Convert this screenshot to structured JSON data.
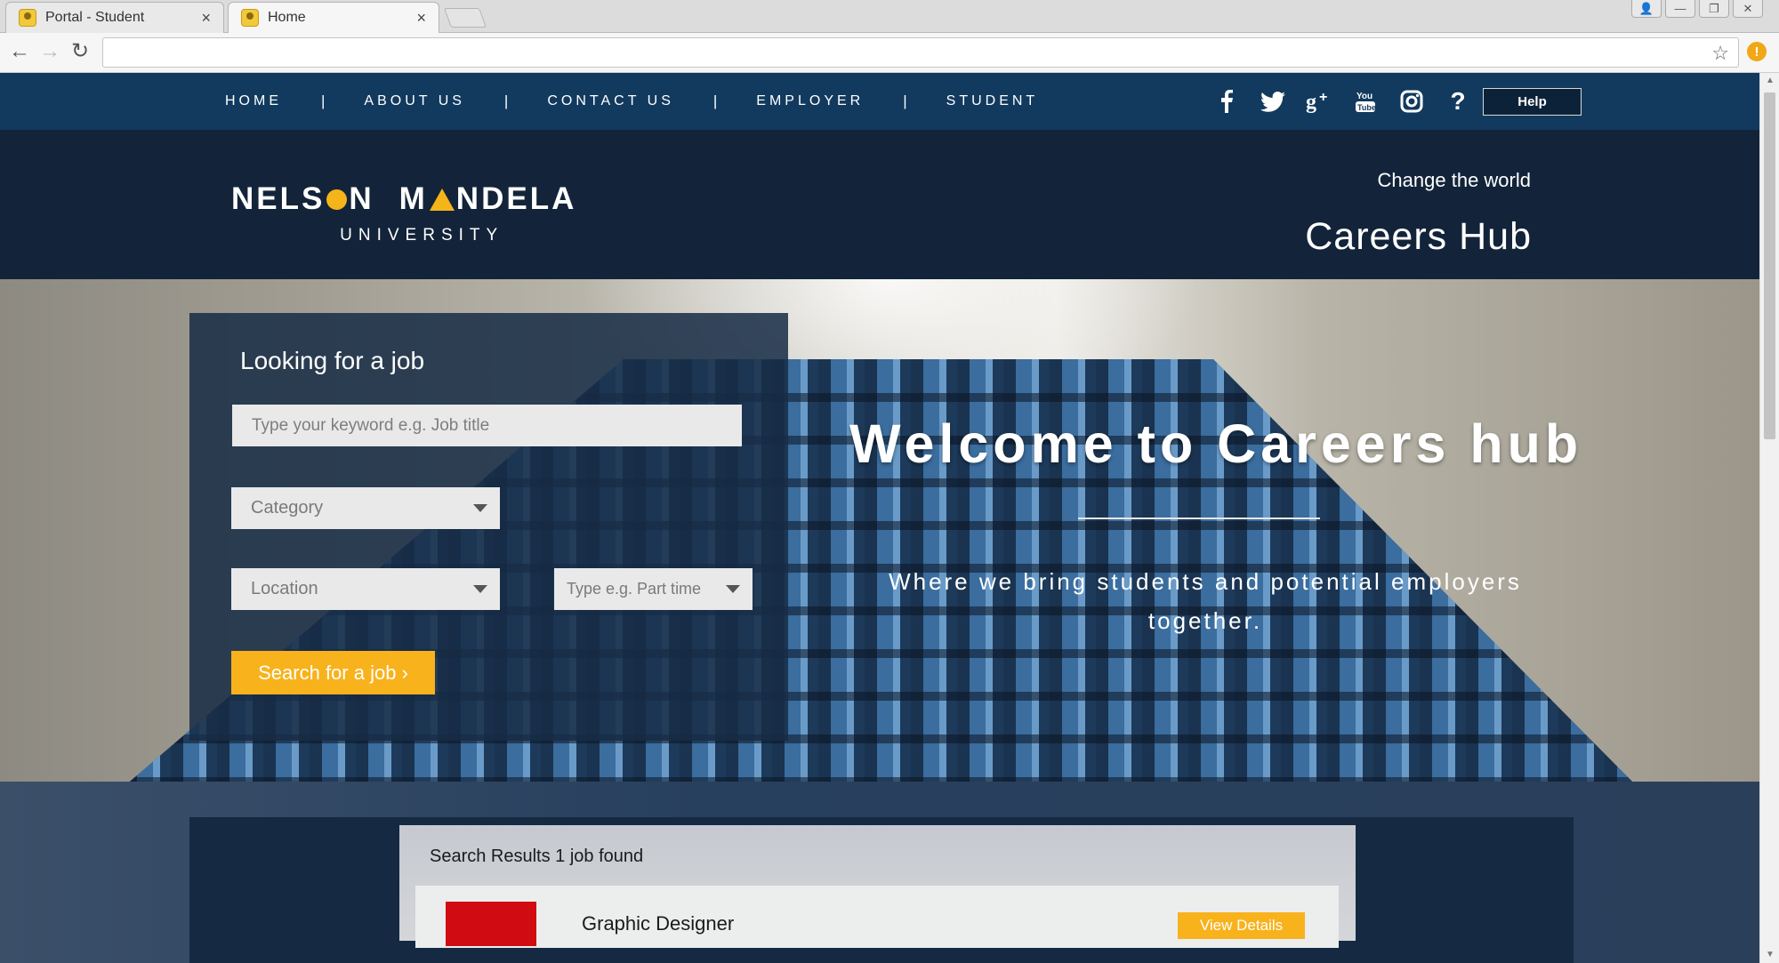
{
  "browser": {
    "tabs": [
      {
        "title": "Portal - Student",
        "close": "×"
      },
      {
        "title": "Home",
        "close": "×"
      }
    ],
    "url": "",
    "window_buttons": [
      "👤",
      "—",
      "❐",
      "✕"
    ]
  },
  "nav": {
    "items": [
      "HOME",
      "ABOUT US",
      "CONTACT US",
      "EMPLOYER",
      "STUDENT"
    ],
    "separator": "|",
    "social": [
      "facebook",
      "twitter",
      "google-plus",
      "youtube",
      "instagram",
      "question"
    ],
    "help": "Help"
  },
  "header": {
    "logo_line1_a": "NELS",
    "logo_line1_b": "N",
    "logo_line1_c": "M",
    "logo_line1_d": "NDELA",
    "logo_line2": "UNIVERSITY",
    "tagline": "Change the world",
    "title": "Careers Hub"
  },
  "search": {
    "title": "Looking for a job",
    "keyword_placeholder": "Type your keyword e.g. Job title",
    "category": "Category",
    "location": "Location",
    "type": "Type e.g. Part time",
    "button": "Search for a job ›"
  },
  "hero": {
    "welcome": "Welcome to Careers hub",
    "subtitle": "Where we bring students and potential employers together."
  },
  "results": {
    "heading": "Search Results 1 job found",
    "items": [
      {
        "title": "Graphic Designer",
        "button": "View Details"
      }
    ]
  },
  "colors": {
    "nav_bg": "#123a5e",
    "header_bg": "#13243a",
    "accent": "#f8b21c",
    "logo_accent": "#f4b51a"
  }
}
